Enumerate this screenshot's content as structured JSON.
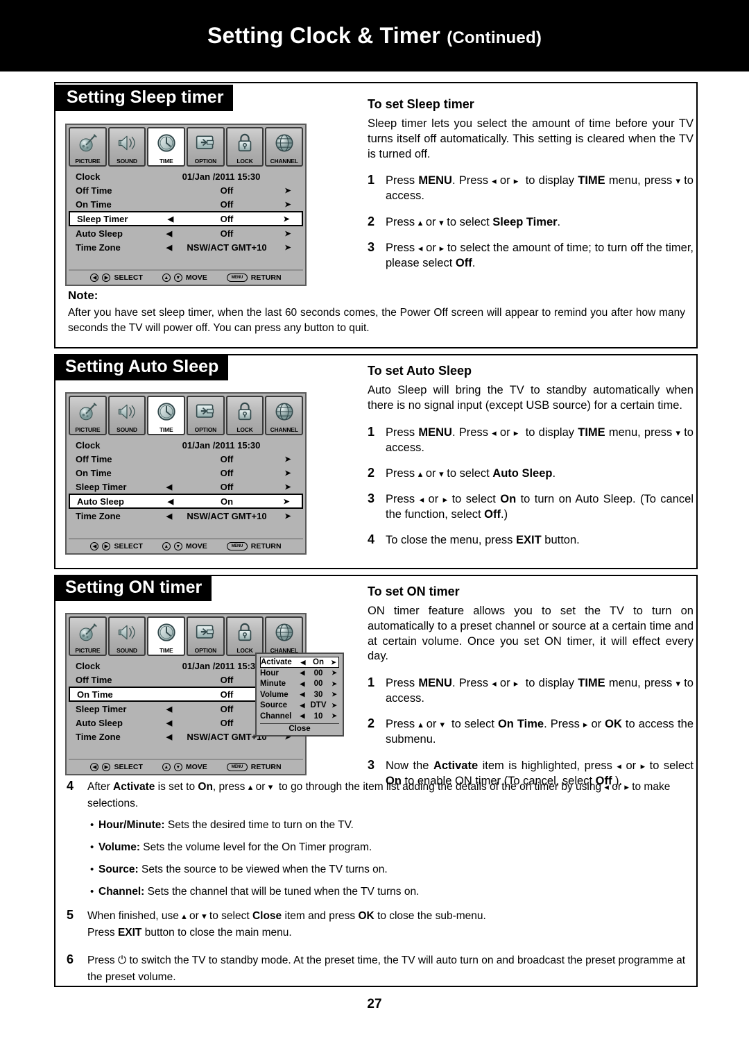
{
  "header": {
    "title": "Setting Clock & Timer",
    "continued": "(Continued)"
  },
  "page_number": "27",
  "osd_common": {
    "tabs": [
      {
        "label": "PICTURE",
        "icon": "picture-icon",
        "selected": false
      },
      {
        "label": "SOUND",
        "icon": "speaker-icon",
        "selected": false
      },
      {
        "label": "TIME",
        "icon": "clock-icon",
        "selected": true
      },
      {
        "label": "OPTION",
        "icon": "wrench-screen-icon",
        "selected": false
      },
      {
        "label": "LOCK",
        "icon": "padlock-icon",
        "selected": false
      },
      {
        "label": "CHANNEL",
        "icon": "globe-icon",
        "selected": false
      }
    ],
    "footer": {
      "select": "SELECT",
      "move": "MOVE",
      "return": "RETURN",
      "menu_key": "MENU"
    },
    "clock_label": "Clock",
    "clock_value": "01/Jan /2011 15:30"
  },
  "section1": {
    "tag": "Setting Sleep timer",
    "osd_rows": [
      {
        "name": "Clock",
        "value": "01/Jan /2011 15:30",
        "left": "",
        "right": "",
        "highlight": false,
        "clock": true
      },
      {
        "name": "Off Time",
        "value": "Off",
        "left": "",
        "right": "➤",
        "highlight": false
      },
      {
        "name": "On Time",
        "value": "Off",
        "left": "",
        "right": "➤",
        "highlight": false
      },
      {
        "name": "Sleep Timer",
        "value": "Off",
        "left": "◀",
        "right": "➤",
        "highlight": true
      },
      {
        "name": "Auto Sleep",
        "value": "Off",
        "left": "◀",
        "right": "➤",
        "highlight": false
      },
      {
        "name": "Time Zone",
        "value": "NSW/ACT GMT+10",
        "left": "◀",
        "right": "➤",
        "highlight": false
      }
    ],
    "heading": "To set Sleep timer",
    "intro": "Sleep timer lets you select the amount of time before your TV turns itself off automatically. This setting is cleared when the TV is turned off.",
    "steps": [
      {
        "num": "1",
        "html": "Press <b>MENU</b>. Press <span class=\"ar\">◂</span> or <span class=\"ar\">▸</span>&nbsp; to display <b>TIME</b> menu, press <span class=\"ar\">▾</span> to access."
      },
      {
        "num": "2",
        "html": "Press <span class=\"ar\">▴</span> or <span class=\"ar\">▾</span> to select <b>Sleep Timer</b>."
      },
      {
        "num": "3",
        "html": "Press <span class=\"ar\">◂</span> or <span class=\"ar\">▸</span> to select the amount of time; to turn off the timer, please select <b>Off</b>."
      }
    ],
    "note_title": "Note:",
    "note_body": "After you have set sleep timer, when the last 60 seconds comes, the Power Off screen will appear to remind you after how many seconds the TV will power off. You can press any button to quit."
  },
  "section2": {
    "tag": "Setting Auto Sleep",
    "osd_rows": [
      {
        "name": "Clock",
        "value": "01/Jan /2011 15:30",
        "left": "",
        "right": "",
        "highlight": false,
        "clock": true
      },
      {
        "name": "Off Time",
        "value": "Off",
        "left": "",
        "right": "➤",
        "highlight": false
      },
      {
        "name": "On Time",
        "value": "Off",
        "left": "",
        "right": "➤",
        "highlight": false
      },
      {
        "name": "Sleep Timer",
        "value": "Off",
        "left": "◀",
        "right": "➤",
        "highlight": false
      },
      {
        "name": "Auto Sleep",
        "value": "On",
        "left": "◀",
        "right": "➤",
        "highlight": true
      },
      {
        "name": "Time Zone",
        "value": "NSW/ACT GMT+10",
        "left": "◀",
        "right": "➤",
        "highlight": false
      }
    ],
    "heading": "To set Auto Sleep",
    "intro": "Auto Sleep will bring the TV to standby automatically when there is no signal input (except USB source) for a certain time.",
    "steps": [
      {
        "num": "1",
        "html": "Press <b>MENU</b>. Press <span class=\"ar\">◂</span> or <span class=\"ar\">▸</span>&nbsp; to display <b>TIME</b> menu, press <span class=\"ar\">▾</span> to access."
      },
      {
        "num": "2",
        "html": "Press <span class=\"ar\">▴</span> or <span class=\"ar\">▾</span> to select <b>Auto Sleep</b>."
      },
      {
        "num": "3",
        "html": "Press <span class=\"ar\">◂</span> or <span class=\"ar\">▸</span> to select <b>On</b> to turn on Auto Sleep. (To cancel the function, select <b>Off</b>.)"
      },
      {
        "num": "4",
        "html": "To close the menu, press <b>EXIT</b> button."
      }
    ]
  },
  "section3": {
    "tag": "Setting ON timer",
    "osd_rows": [
      {
        "name": "Clock",
        "value": "01/Jan /2011 15:30",
        "left": "",
        "right": "",
        "highlight": false,
        "clock": true
      },
      {
        "name": "Off Time",
        "value": "Off",
        "left": "",
        "right": "➤",
        "highlight": false
      },
      {
        "name": "On Time",
        "value": "Off",
        "left": "",
        "right": "➤",
        "highlight": true
      },
      {
        "name": "Sleep Timer",
        "value": "Off",
        "left": "◀",
        "right": "➤",
        "highlight": false
      },
      {
        "name": "Auto Sleep",
        "value": "Off",
        "left": "◀",
        "right": "➤",
        "highlight": false
      },
      {
        "name": "Time Zone",
        "value": "NSW/ACT GMT+10",
        "left": "◀",
        "right": "➤",
        "highlight": false
      }
    ],
    "submenu": {
      "rows": [
        {
          "name": "Activate",
          "value": "On",
          "highlight": true
        },
        {
          "name": "Hour",
          "value": "00",
          "highlight": false
        },
        {
          "name": "Minute",
          "value": "00",
          "highlight": false
        },
        {
          "name": "Volume",
          "value": "30",
          "highlight": false
        },
        {
          "name": "Source",
          "value": "DTV",
          "highlight": false
        },
        {
          "name": "Channel",
          "value": "10",
          "highlight": false
        }
      ],
      "close_label": "Close",
      "left_arrow": "◀",
      "right_arrow": "➤"
    },
    "heading": "To set ON timer",
    "intro": "ON timer feature allows you to set the TV to turn on automatically to a preset channel or source at a certain time and at certain volume. Once you set ON timer, it will effect every day.",
    "steps": [
      {
        "num": "1",
        "html": "Press <b>MENU</b>. Press <span class=\"ar\">◂</span> or <span class=\"ar\">▸</span>&nbsp; to display <b>TIME</b> menu, press <span class=\"ar\">▾</span> to access."
      },
      {
        "num": "2",
        "html": "Press <span class=\"ar\">▴</span> or <span class=\"ar\">▾</span>&nbsp; to select <b>On&nbsp;Time</b>. Press <span class=\"ar\">▸</span> or <b>OK</b> to access the submenu."
      },
      {
        "num": "3",
        "html": "Now the <b>Activate</b> item is highlighted, press <span class=\"ar\">◂</span> or <span class=\"ar\">▸</span> to select <b>On</b> to enable ON timer (To cancel, select <b>Off</b> )."
      }
    ],
    "bottom_steps": [
      {
        "num": "4",
        "html": "After <b>Activate</b> is set to <b>On</b>, press <span class=\"ar\">▴</span> or <span class=\"ar\">▾</span>&nbsp; to go through the item list adding the details of the on timer by using <span class=\"ar\">◂</span> or <span class=\"ar\">▸</span> to make selections."
      }
    ],
    "bullets": [
      {
        "html": "<b>Hour/Minute:</b> Sets the desired time to turn on the TV."
      },
      {
        "html": "<b>Volume:</b> Sets the volume level for the On Timer program."
      },
      {
        "html": "<b>Source:</b> Sets the source to be viewed when the TV turns on."
      },
      {
        "html": "<b>Channel:</b> Sets the channel that will be tuned when the TV turns on."
      }
    ],
    "bottom_steps2": [
      {
        "num": "5",
        "html": "When finished, use <span class=\"ar\">▴</span> or <span class=\"ar\">▾</span> to select <b>Close</b> item and press <b>OK</b> to close the sub-menu.<br>Press <b>EXIT</b> button to close the main menu."
      },
      {
        "num": "6",
        "html": "Press ⏻ to switch the TV to standby mode. At the preset time, the TV will auto turn on and broadcast the preset programme at the preset volume."
      }
    ]
  }
}
